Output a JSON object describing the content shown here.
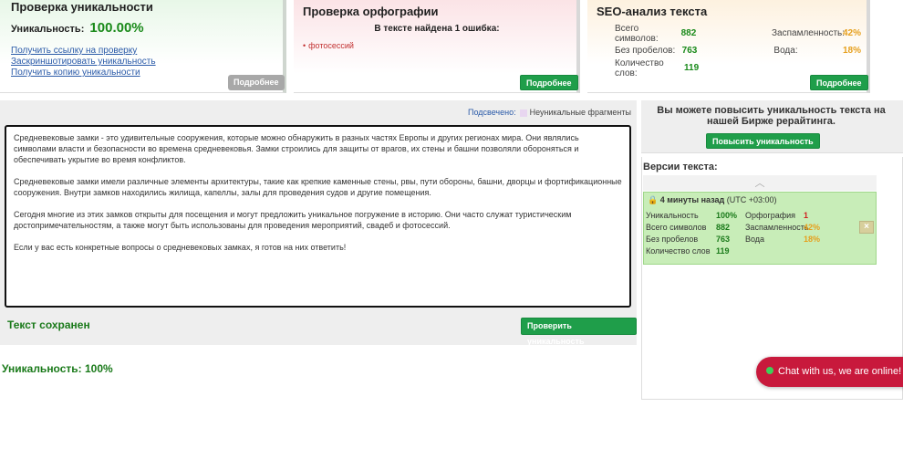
{
  "uniqueness_panel": {
    "title": "Проверка уникальности",
    "label": "Уникальность:",
    "value": "100.00%",
    "links": [
      "Получить ссылку на проверку",
      "Заскриншотировать уникальность",
      "Получить копию уникальности"
    ],
    "details_button": "Подробнее"
  },
  "spelling_panel": {
    "title": "Проверка орфографии",
    "summary": "В тексте найдена 1 ошибка:",
    "errors": [
      "фотосессий"
    ],
    "details_button": "Подробнее"
  },
  "seo_panel": {
    "title": "SEO-анализ текста",
    "rows": [
      {
        "k": "Всего символов:",
        "v": "882",
        "k2": "Заспамленность:",
        "v2": "42%"
      },
      {
        "k": "Без пробелов:",
        "v": "763",
        "k2": "Вода:",
        "v2": "18%"
      },
      {
        "k": "Количество слов:",
        "v": "119",
        "k2": "",
        "v2": ""
      }
    ],
    "details_button": "Подробнее"
  },
  "legend": {
    "highlighted_label": "Подсвечено:",
    "fragments_label": "Неуникальные фрагменты"
  },
  "editor": {
    "paragraphs": [
      "Средневековые замки - это удивительные сооружения, которые можно обнаружить в разных частях Европы и других регионах мира. Они являлись символами власти и безопасности во времена средневековья. Замки строились для защиты от врагов, их стены и башни позволяли обороняться и обеспечивать укрытие во время конфликтов.",
      "Средневековые замки имели различные элементы архитектуры, такие как крепкие каменные стены, рвы, пути обороны, башни, дворцы и фортификационные сооружения. Внутри замков находились жилища, капеллы, залы для проведения судов и другие помещения.",
      "Сегодня многие из этих замков открыты для посещения и могут предложить уникальное погружение в историю. Они часто служат туристическим достопримечательностям, а также могут быть использованы для проведения мероприятий, свадеб и фотосессий.",
      "Если у вас есть конкретные вопросы о средневековых замках, я готов на них ответить!"
    ]
  },
  "status": {
    "saved": "Текст сохранен",
    "check_button": "Проверить уникальность",
    "result": "Уникальность: 100%"
  },
  "promo": {
    "text": "Вы можете повысить уникальность текста на нашей Бирже рерайтинга.",
    "button": "Повысить уникальность"
  },
  "versions": {
    "title": "Версии текста:",
    "card": {
      "time": "4 минуты назад",
      "timezone": "(UTC +03:00)",
      "rows": [
        {
          "k": "Уникальность",
          "v": "100%",
          "k2": "Орфография",
          "v2": "1",
          "v2_color": "#d02020"
        },
        {
          "k": "Всего символов",
          "v": "882",
          "k2": "Заспамленность",
          "v2": "42%",
          "v2_color": "#e6a01e"
        },
        {
          "k": "Без пробелов",
          "v": "763",
          "k2": "Вода",
          "v2": "18%",
          "v2_color": "#e6a01e"
        },
        {
          "k": "Количество слов",
          "v": "119",
          "k2": "",
          "v2": "",
          "v2_color": ""
        }
      ]
    }
  },
  "chat": {
    "text": "Chat with us, we are online!"
  },
  "colors": {
    "green": "#1f9e4a",
    "result_green": "#1a7a1a",
    "warning_orange": "#e6a01e",
    "error_red": "#d02020",
    "chat_red": "#c8193c"
  }
}
